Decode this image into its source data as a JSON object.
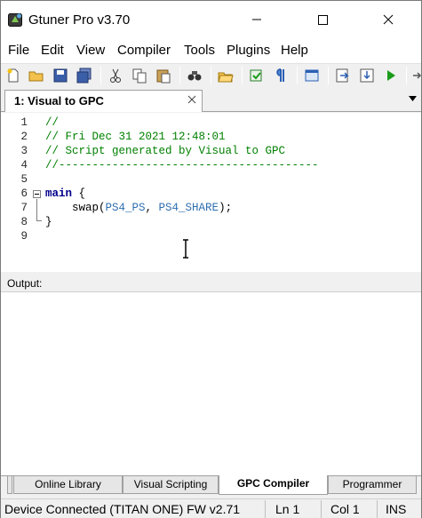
{
  "window": {
    "title": "Gtuner Pro v3.70"
  },
  "menu": [
    "File",
    "Edit",
    "View",
    "Compiler",
    "Tools",
    "Plugins",
    "Help"
  ],
  "document_tab": {
    "label": "1: Visual to GPC"
  },
  "editor": {
    "lines": [
      {
        "n": "1",
        "text": "//"
      },
      {
        "n": "2",
        "text": "// Fri Dec 31 2021 12:48:01"
      },
      {
        "n": "3",
        "text": "// Script generated by Visual to GPC"
      },
      {
        "n": "4",
        "text": "//---------------------------------------"
      },
      {
        "n": "5",
        "text": ""
      },
      {
        "n": "6",
        "kw": "main",
        "rest": " {"
      },
      {
        "n": "7",
        "fn": "    swap(",
        "c1": "PS4_PS",
        "mid": ", ",
        "c2": "PS4_SHARE",
        "end": ");"
      },
      {
        "n": "8",
        "text": "}"
      },
      {
        "n": "9",
        "text": ""
      }
    ]
  },
  "output": {
    "label": "Output:"
  },
  "bottom_tabs": [
    "Online Library",
    "Visual Scripting",
    "GPC Compiler",
    "Programmer"
  ],
  "active_bottom_tab": "GPC Compiler",
  "status": {
    "device": "Device Connected (TITAN ONE) FW v2.71",
    "line": "Ln 1",
    "col": "Col 1",
    "mode": "INS"
  },
  "colors": {
    "comment": "#008000",
    "keyword": "#00008b",
    "constant": "#2e6fb0",
    "run_green": "#1a9c1a"
  },
  "toolbar_icons": [
    "new-file-icon",
    "open-folder-icon",
    "save-icon",
    "save-all-icon",
    "cut-icon",
    "copy-icon",
    "paste-icon",
    "find-icon",
    "open-project-icon",
    "compile-icon",
    "format-icon",
    "window-icon",
    "build-icon",
    "download-icon",
    "run-icon",
    "next-icon"
  ]
}
